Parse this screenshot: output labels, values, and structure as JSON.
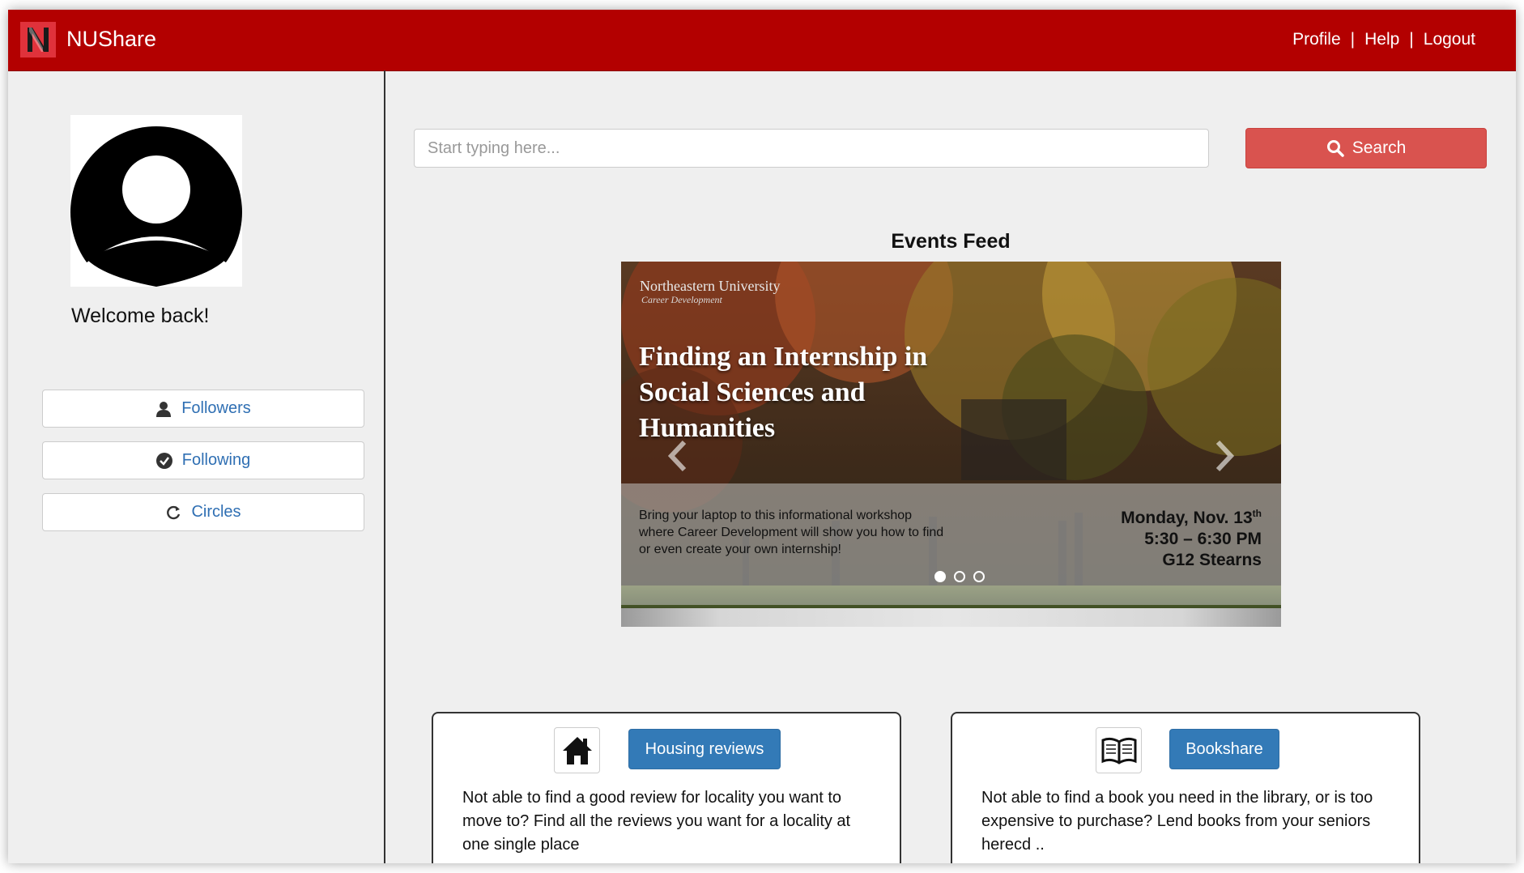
{
  "navbar": {
    "brand_letter": "N",
    "brand_name": "NUShare",
    "links": [
      "Profile",
      "Help",
      "Logout"
    ],
    "separator": "|",
    "color": "#b30000"
  },
  "sidebar": {
    "welcome": "Welcome back!",
    "buttons": [
      {
        "label": "Followers",
        "icon": "user-icon"
      },
      {
        "label": "Following",
        "icon": "check-circle-icon"
      },
      {
        "label": "Circles",
        "icon": "refresh-icon"
      }
    ]
  },
  "search": {
    "placeholder": "Start typing here...",
    "button_label": "Search",
    "button_color": "#d9534f"
  },
  "events": {
    "title": "Events Feed",
    "slide": {
      "org": "Northeastern University",
      "org_sub": "Career Development",
      "title": "Finding an Internship in Social Sciences and Humanities",
      "description": "Bring your laptop to this informational workshop where Career Development will show you how to find or even create your own internship!",
      "date_main": "Monday, Nov. 13",
      "date_suffix": "th",
      "time": "5:30 – 6:30 PM",
      "location": "G12 Stearns"
    },
    "slide_count": 3,
    "active_slide": 1
  },
  "cards": [
    {
      "icon": "home-icon",
      "button_label": "Housing reviews",
      "text": "Not able to find a good review for locality you want to move to? Find all the reviews you want for a locality at one single place"
    },
    {
      "icon": "book-icon",
      "button_label": "Bookshare",
      "text": "Not able to find a book you need in the library, or is too expensive to purchase? Lend books from your seniors herecd .."
    }
  ],
  "colors": {
    "primary_button": "#337ab7",
    "link": "#2f6fb3"
  }
}
